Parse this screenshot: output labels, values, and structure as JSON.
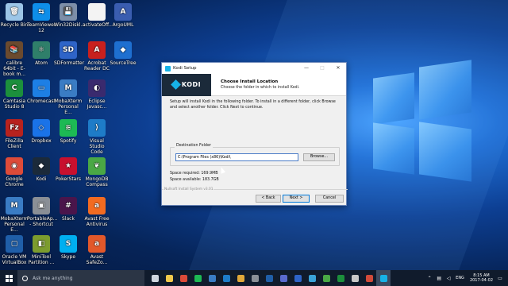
{
  "desktop_icons": [
    {
      "label": "Recycle Bin",
      "color": "#9cc6e8",
      "glyph": "🗑",
      "icon": "recycle-bin-icon"
    },
    {
      "label": "TeamViewer 12",
      "color": "#0e8ee9",
      "glyph": "⇆",
      "icon": "teamviewer-icon"
    },
    {
      "label": "Win32Diskl...",
      "color": "#7d8fa8",
      "glyph": "💾",
      "icon": "win32disk-icon"
    },
    {
      "label": "activateOff...",
      "color": "#f3f3f3",
      "glyph": "",
      "icon": "file-icon"
    },
    {
      "label": "ArgoUML",
      "color": "#3a5db0",
      "glyph": "A",
      "icon": "argouml-icon"
    },
    {
      "label": "calibre 64bit - E-book m...",
      "color": "#6b4a2e",
      "glyph": "📚",
      "icon": "calibre-icon"
    },
    {
      "label": "Atom",
      "color": "#2f7f6a",
      "glyph": "⚛",
      "icon": "atom-icon"
    },
    {
      "label": "SDFormatter",
      "color": "#2e64c8",
      "glyph": "SD",
      "icon": "sdformatter-icon"
    },
    {
      "label": "Acrobat Reader DC",
      "color": "#c8201e",
      "glyph": "A",
      "icon": "acrobat-icon"
    },
    {
      "label": "SourceTree",
      "color": "#1e6fd0",
      "glyph": "◆",
      "icon": "sourcetree-icon"
    },
    {
      "label": "Camtasia Studio 8",
      "color": "#1c8f3c",
      "glyph": "C",
      "icon": "camtasia-icon"
    },
    {
      "label": "Chromecast",
      "color": "#1d7fe5",
      "glyph": "▭",
      "icon": "chromecast-icon"
    },
    {
      "label": "MobaXterm Personal E...",
      "color": "#3a7cc4",
      "glyph": "M",
      "icon": "mobaxterm-icon"
    },
    {
      "label": "Eclipse Javasc...",
      "color": "#3a2a6e",
      "glyph": "◐",
      "icon": "eclipse-icon"
    },
    {
      "label": "FileZilla Client",
      "color": "#b8221e",
      "glyph": "Fz",
      "icon": "filezilla-icon"
    },
    {
      "label": "Dropbox",
      "color": "#1a73e8",
      "glyph": "◇",
      "icon": "dropbox-icon"
    },
    {
      "label": "Spotify",
      "color": "#1db954",
      "glyph": "≋",
      "icon": "spotify-icon"
    },
    {
      "label": "Visual Studio Code",
      "color": "#1e7cc8",
      "glyph": "⟩",
      "icon": "vscode-icon"
    },
    {
      "label": "Google Chrome",
      "color": "#dd4b39",
      "glyph": "◉",
      "icon": "chrome-icon"
    },
    {
      "label": "Kodi",
      "color": "#1b2a3a",
      "glyph": "◆",
      "icon": "kodi-icon"
    },
    {
      "label": "PokerStars",
      "color": "#c8102e",
      "glyph": "★",
      "icon": "pokerstars-icon"
    },
    {
      "label": "MongoDB Compass",
      "color": "#4aa845",
      "glyph": "❦",
      "icon": "mongodb-icon"
    },
    {
      "label": "MobaXterm Personal E...",
      "color": "#3a7cc4",
      "glyph": "M",
      "icon": "mobaxterm-icon"
    },
    {
      "label": "PortableAp... - Shortcut",
      "color": "#8a8f96",
      "glyph": "▣",
      "icon": "portableapps-icon"
    },
    {
      "label": "Slack",
      "color": "#4a154b",
      "glyph": "#",
      "icon": "slack-icon"
    },
    {
      "label": "Avast Free Antivirus",
      "color": "#f26b21",
      "glyph": "a",
      "icon": "avast-icon"
    },
    {
      "label": "Oracle VM VirtualBox",
      "color": "#1f5ea8",
      "glyph": "▢",
      "icon": "virtualbox-icon"
    },
    {
      "label": "MiniTool Partition ...",
      "color": "#7c9c2e",
      "glyph": "◧",
      "icon": "minitool-icon"
    },
    {
      "label": "Skype",
      "color": "#00aff0",
      "glyph": "S",
      "icon": "skype-icon"
    },
    {
      "label": "Avast SafeZo...",
      "color": "#e2582a",
      "glyph": "a",
      "icon": "avast-safezone-icon"
    }
  ],
  "setup_window": {
    "title": "Kodi Setup",
    "controls": [
      "—",
      "□",
      "✕"
    ],
    "logo_text": "KODI",
    "header_title": "Choose Install Location",
    "header_subtitle": "Choose the folder in which to install Kodi.",
    "body_text": "Setup will install Kodi in the following folder. To install in a different folder, click Browse and select another folder. Click Next to continue.",
    "destination_label": "Destination Folder",
    "destination_value": "C:\\Program Files (x86)\\Kodi\\",
    "browse_label": "Browse...",
    "space_required": "Space required: 169.9MB",
    "space_available": "Space available: 183.7GB",
    "nsis_label": "Nullsoft Install System v3.01",
    "back_label": "< Back",
    "next_label": "Next >",
    "cancel_label": "Cancel"
  },
  "taskbar": {
    "search_placeholder": "Ask me anything",
    "apps": [
      {
        "icon": "task-view-icon",
        "color": "#cfd6df",
        "active": false
      },
      {
        "icon": "file-explorer-icon",
        "color": "#f2c94c",
        "active": false
      },
      {
        "icon": "chrome-icon",
        "color": "#dd4b39",
        "active": false
      },
      {
        "icon": "spotify-icon",
        "color": "#1db954",
        "active": false
      },
      {
        "icon": "app-icon",
        "color": "#3a7cc4",
        "active": false
      },
      {
        "icon": "vscode-icon",
        "color": "#1e7cc8",
        "active": false
      },
      {
        "icon": "folder-icon",
        "color": "#e0a83a",
        "active": false
      },
      {
        "icon": "app-icon-2",
        "color": "#8a8f96",
        "active": false
      },
      {
        "icon": "virtualbox-icon",
        "color": "#1f5ea8",
        "active": false
      },
      {
        "icon": "app-icon-3",
        "color": "#5a6acf",
        "active": false
      },
      {
        "icon": "app-icon-4",
        "color": "#2e64c8",
        "active": false
      },
      {
        "icon": "app-icon-5",
        "color": "#3aa3d8",
        "active": false
      },
      {
        "icon": "app-icon-6",
        "color": "#4aa845",
        "active": false
      },
      {
        "icon": "camtasia-icon",
        "color": "#1c8f3c",
        "active": false
      },
      {
        "icon": "app-icon-7",
        "color": "#c8c8c8",
        "active": false
      },
      {
        "icon": "app-icon-8",
        "color": "#d14b3a",
        "active": false
      },
      {
        "icon": "kodi-icon",
        "color": "#17b2e7",
        "active": true
      }
    ],
    "tray_lang": "ENG",
    "time": "8:15 AM",
    "date": "2017-04-02"
  }
}
